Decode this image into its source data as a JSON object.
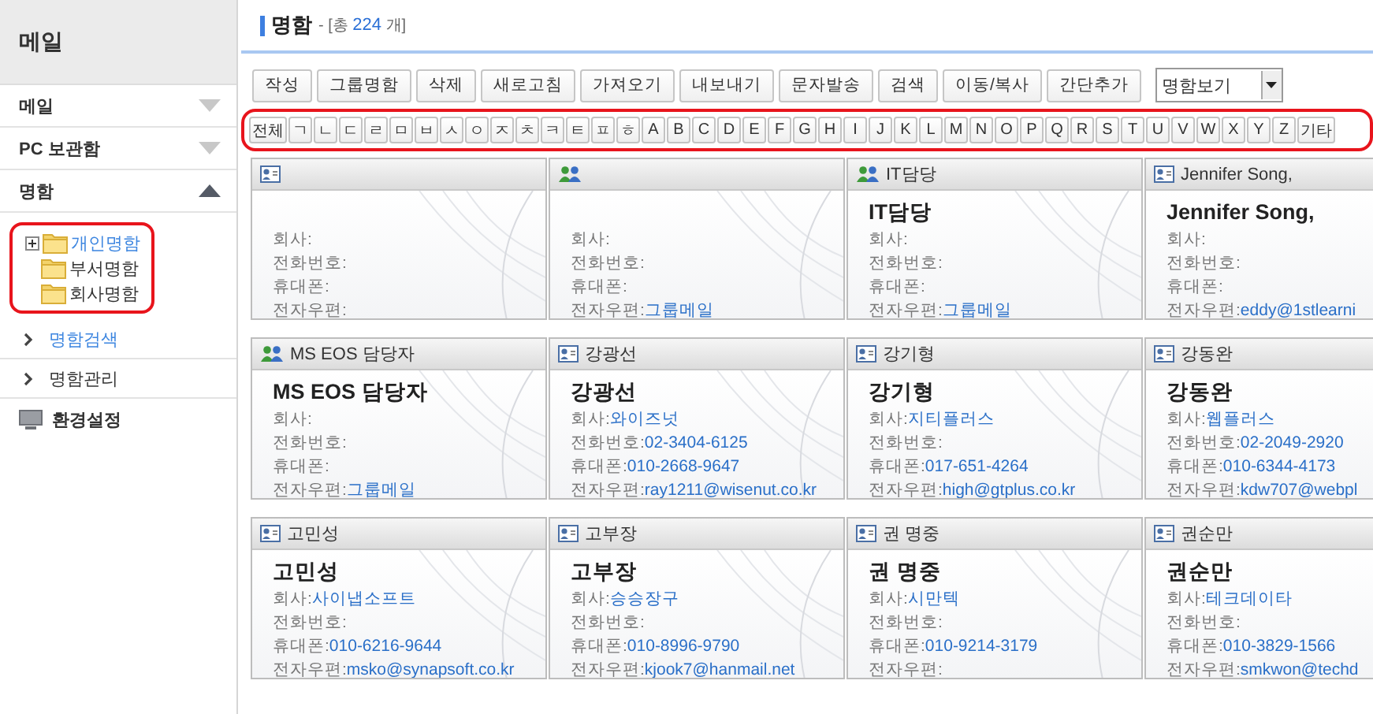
{
  "sidebar": {
    "title": "메일",
    "sections": [
      {
        "label": "메일",
        "expanded": false
      },
      {
        "label": "PC 보관함",
        "expanded": false
      },
      {
        "label": "명함",
        "expanded": true
      }
    ],
    "tree": {
      "highlighted": true,
      "items": [
        {
          "label": "개인명함",
          "selected": true,
          "collapsed": true
        },
        {
          "label": "부서명함",
          "selected": false,
          "collapsed": false
        },
        {
          "label": "회사명함",
          "selected": false,
          "collapsed": false
        }
      ]
    },
    "links": [
      {
        "label": "명함검색",
        "selected": true
      },
      {
        "label": "명함관리",
        "selected": false
      }
    ],
    "settings": "환경설정"
  },
  "header": {
    "title": "명함",
    "count_prefix": "- [총",
    "count": "224",
    "count_suffix": "개]"
  },
  "toolbar": {
    "buttons": [
      "작성",
      "그룹명함",
      "삭제",
      "새로고침",
      "가져오기",
      "내보내기",
      "문자발송",
      "검색",
      "이동/복사",
      "간단추가"
    ],
    "view_select": "명함보기"
  },
  "index_bar": {
    "highlighted": true,
    "keys": [
      "전체",
      "ㄱ",
      "ㄴ",
      "ㄷ",
      "ㄹ",
      "ㅁ",
      "ㅂ",
      "ㅅ",
      "ㅇ",
      "ㅈ",
      "ㅊ",
      "ㅋ",
      "ㅌ",
      "ㅍ",
      "ㅎ",
      "A",
      "B",
      "C",
      "D",
      "E",
      "F",
      "G",
      "H",
      "I",
      "J",
      "K",
      "L",
      "M",
      "N",
      "O",
      "P",
      "Q",
      "R",
      "S",
      "T",
      "U",
      "V",
      "W",
      "X",
      "Y",
      "Z",
      "기타"
    ]
  },
  "cards": [
    {
      "kind": "person",
      "fields": [
        {
          "label": "회사:"
        },
        {
          "label": "전화번호:"
        },
        {
          "label": "휴대폰:"
        },
        {
          "label": "전자우편:"
        }
      ]
    },
    {
      "kind": "group",
      "fields": [
        {
          "label": "회사:"
        },
        {
          "label": "전화번호:"
        },
        {
          "label": "휴대폰:"
        },
        {
          "label": "전자우편:",
          "value": "그룹메일"
        }
      ]
    },
    {
      "kind": "group",
      "title": "IT담당",
      "name": "IT담당",
      "fields": [
        {
          "label": "회사:"
        },
        {
          "label": "전화번호:"
        },
        {
          "label": "휴대폰:"
        },
        {
          "label": "전자우편:",
          "value": "그룹메일"
        }
      ]
    },
    {
      "kind": "person",
      "title": "Jennifer Song,",
      "name": "Jennifer Song,",
      "fields": [
        {
          "label": "회사:"
        },
        {
          "label": "전화번호:"
        },
        {
          "label": "휴대폰:"
        },
        {
          "label": "전자우편:",
          "value": "eddy@1stlearni"
        }
      ]
    },
    {
      "kind": "group",
      "title": "MS EOS 담당자",
      "name": "MS EOS 담당자",
      "fields": [
        {
          "label": "회사:"
        },
        {
          "label": "전화번호:"
        },
        {
          "label": "휴대폰:"
        },
        {
          "label": "전자우편:",
          "value": "그룹메일"
        }
      ]
    },
    {
      "kind": "person",
      "title": "강광선",
      "name": "강광선",
      "fields": [
        {
          "label": "회사:",
          "value": "와이즈넛"
        },
        {
          "label": "전화번호:",
          "value": "02-3404-6125"
        },
        {
          "label": "휴대폰:",
          "value": "010-2668-9647"
        },
        {
          "label": "전자우편:",
          "value": "ray1211@wisenut.co.kr"
        }
      ]
    },
    {
      "kind": "person",
      "title": "강기형",
      "name": "강기형",
      "fields": [
        {
          "label": "회사:",
          "value": "지티플러스"
        },
        {
          "label": "전화번호:"
        },
        {
          "label": "휴대폰:",
          "value": "017-651-4264"
        },
        {
          "label": "전자우편:",
          "value": "high@gtplus.co.kr"
        }
      ]
    },
    {
      "kind": "person",
      "title": "강동완",
      "name": "강동완",
      "fields": [
        {
          "label": "회사:",
          "value": "웹플러스"
        },
        {
          "label": "전화번호:",
          "value": "02-2049-2920"
        },
        {
          "label": "휴대폰:",
          "value": "010-6344-4173"
        },
        {
          "label": "전자우편:",
          "value": "kdw707@webpl"
        }
      ]
    },
    {
      "kind": "person",
      "title": "고민성",
      "name": "고민성",
      "fields": [
        {
          "label": "회사:",
          "value": "사이냅소프트"
        },
        {
          "label": "전화번호:"
        },
        {
          "label": "휴대폰:",
          "value": "010-6216-9644"
        },
        {
          "label": "전자우편:",
          "value": "msko@synapsoft.co.kr"
        }
      ]
    },
    {
      "kind": "person",
      "title": "고부장",
      "name": "고부장",
      "fields": [
        {
          "label": "회사:",
          "value": "승승장구"
        },
        {
          "label": "전화번호:"
        },
        {
          "label": "휴대폰:",
          "value": "010-8996-9790"
        },
        {
          "label": "전자우편:",
          "value": "kjook7@hanmail.net"
        }
      ]
    },
    {
      "kind": "person",
      "title": "권 명중",
      "name": "권 명중",
      "fields": [
        {
          "label": "회사:",
          "value": "시만텍"
        },
        {
          "label": "전화번호:"
        },
        {
          "label": "휴대폰:",
          "value": "010-9214-3179"
        },
        {
          "label": "전자우편:"
        }
      ]
    },
    {
      "kind": "person",
      "title": "권순만",
      "name": "권순만",
      "fields": [
        {
          "label": "회사:",
          "value": "테크데이타"
        },
        {
          "label": "전화번호:"
        },
        {
          "label": "휴대폰:",
          "value": "010-3829-1566"
        },
        {
          "label": "전자우편:",
          "value": "smkwon@techd"
        }
      ]
    }
  ]
}
